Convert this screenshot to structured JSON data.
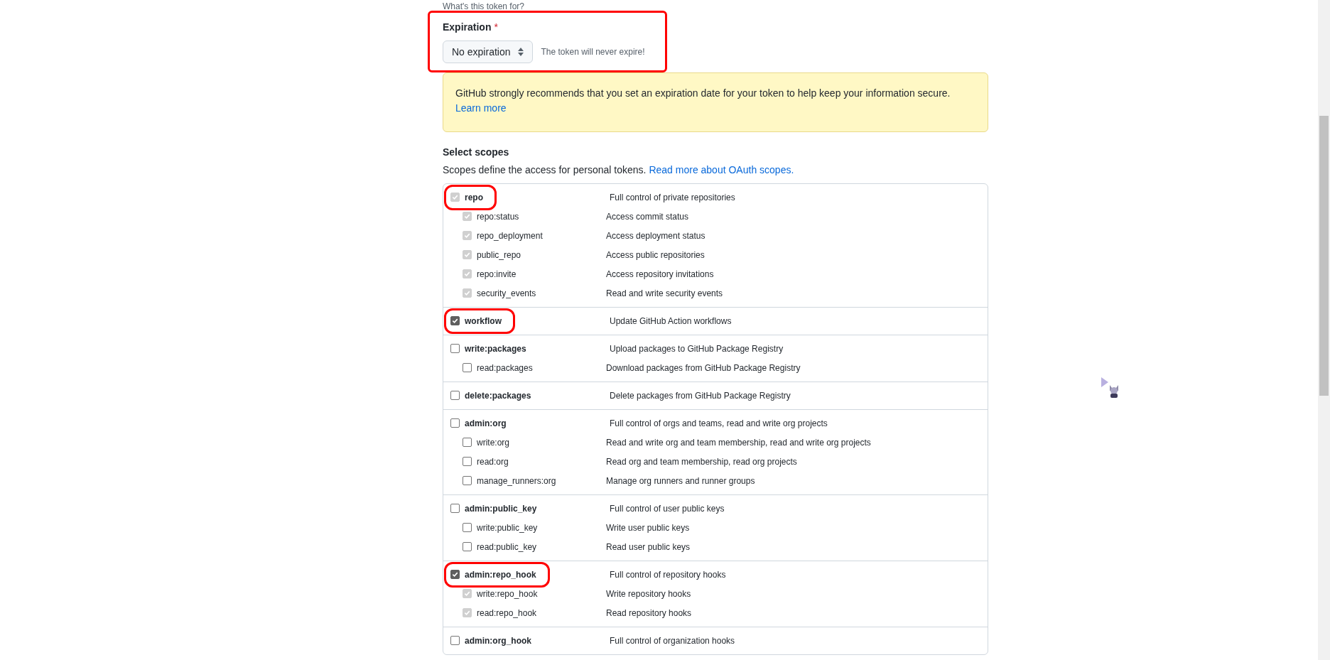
{
  "note_label": "What's this token for?",
  "expiration": {
    "label": "Expiration",
    "required_mark": "*",
    "value": "No expiration",
    "hint": "The token will never expire!",
    "highlighted": true
  },
  "banner": {
    "text": "GitHub strongly recommends that you set an expiration date for your token to help keep your information secure.",
    "link": "Learn more"
  },
  "scopes_heading": "Select scopes",
  "scopes_description": {
    "text": "Scopes define the access for personal tokens.",
    "link": "Read more about OAuth scopes."
  },
  "scope_groups": [
    {
      "name": "repo",
      "description": "Full control of private repositories",
      "checked": true,
      "disabled": true,
      "highlighted": true,
      "children": [
        {
          "name": "repo:status",
          "description": "Access commit status",
          "checked": true,
          "disabled": true
        },
        {
          "name": "repo_deployment",
          "description": "Access deployment status",
          "checked": true,
          "disabled": true
        },
        {
          "name": "public_repo",
          "description": "Access public repositories",
          "checked": true,
          "disabled": true
        },
        {
          "name": "repo:invite",
          "description": "Access repository invitations",
          "checked": true,
          "disabled": true
        },
        {
          "name": "security_events",
          "description": "Read and write security events",
          "checked": true,
          "disabled": true
        }
      ]
    },
    {
      "name": "workflow",
      "description": "Update GitHub Action workflows",
      "checked": true,
      "disabled": false,
      "highlighted": true
    },
    {
      "name": "write:packages",
      "description": "Upload packages to GitHub Package Registry",
      "checked": false,
      "disabled": false,
      "highlighted": false,
      "children": [
        {
          "name": "read:packages",
          "description": "Download packages from GitHub Package Registry",
          "checked": false,
          "disabled": false
        }
      ]
    },
    {
      "name": "delete:packages",
      "description": "Delete packages from GitHub Package Registry",
      "checked": false,
      "disabled": false,
      "highlighted": false
    },
    {
      "name": "admin:org",
      "description": "Full control of orgs and teams, read and write org projects",
      "checked": false,
      "disabled": false,
      "highlighted": false,
      "children": [
        {
          "name": "write:org",
          "description": "Read and write org and team membership, read and write org projects",
          "checked": false,
          "disabled": false
        },
        {
          "name": "read:org",
          "description": "Read org and team membership, read org projects",
          "checked": false,
          "disabled": false
        },
        {
          "name": "manage_runners:org",
          "description": "Manage org runners and runner groups",
          "checked": false,
          "disabled": false
        }
      ]
    },
    {
      "name": "admin:public_key",
      "description": "Full control of user public keys",
      "checked": false,
      "disabled": false,
      "highlighted": false,
      "children": [
        {
          "name": "write:public_key",
          "description": "Write user public keys",
          "checked": false,
          "disabled": false
        },
        {
          "name": "read:public_key",
          "description": "Read user public keys",
          "checked": false,
          "disabled": false
        }
      ]
    },
    {
      "name": "admin:repo_hook",
      "description": "Full control of repository hooks",
      "checked": true,
      "disabled": false,
      "highlighted": true,
      "children": [
        {
          "name": "write:repo_hook",
          "description": "Write repository hooks",
          "checked": true,
          "disabled": true
        },
        {
          "name": "read:repo_hook",
          "description": "Read repository hooks",
          "checked": true,
          "disabled": true
        }
      ]
    },
    {
      "name": "admin:org_hook",
      "description": "Full control of organization hooks",
      "checked": false,
      "disabled": false,
      "highlighted": false
    }
  ]
}
